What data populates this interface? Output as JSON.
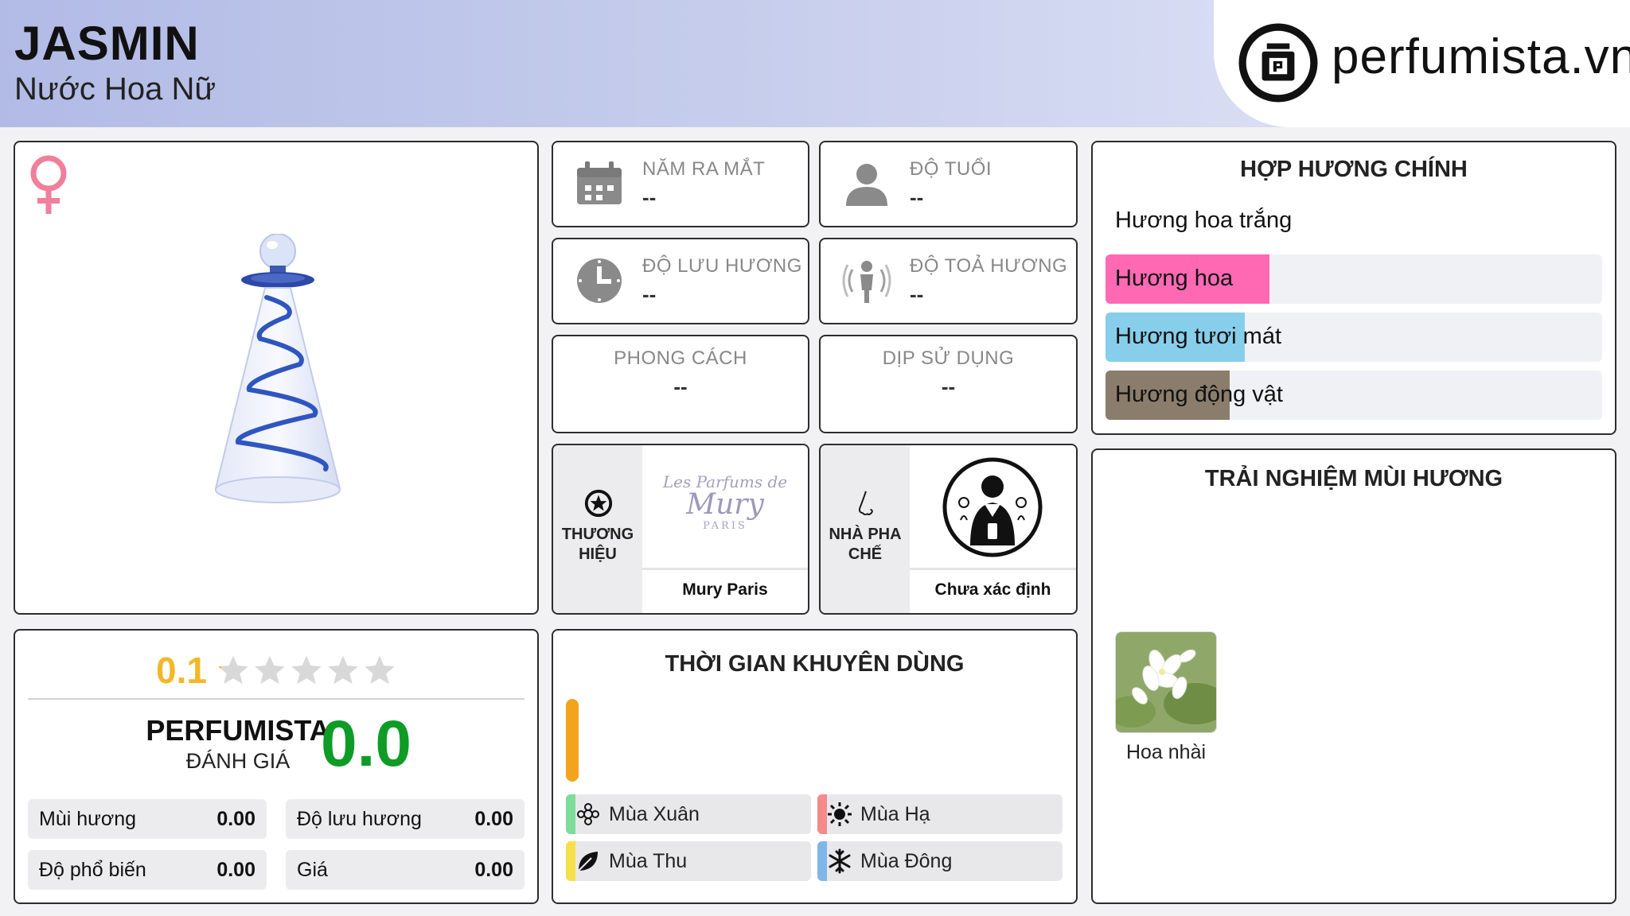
{
  "header": {
    "title": "JASMIN",
    "subtitle": "Nước Hoa Nữ",
    "logo_text": "perfumista.vn"
  },
  "product": {
    "gender_icon": "female-symbol-icon",
    "image": "perfume-bottle"
  },
  "rating": {
    "user_score": "0.1",
    "stars_total": 5,
    "stars_filled_fraction": 0.02,
    "perfumista_label": "PERFUMISTA",
    "perfumista_sublabel": "ĐÁNH GIÁ",
    "perfumista_score": "0.0",
    "metrics": [
      {
        "label": "Mùi hương",
        "value": "0.00"
      },
      {
        "label": "Độ lưu hương",
        "value": "0.00"
      },
      {
        "label": "Độ phổ biến",
        "value": "0.00"
      },
      {
        "label": "Giá",
        "value": "0.00"
      }
    ]
  },
  "info": {
    "release_year": {
      "label": "NĂM RA MẮT",
      "value": "--",
      "icon": "calendar-icon"
    },
    "age": {
      "label": "ĐỘ TUỔI",
      "value": "--",
      "icon": "person-icon"
    },
    "longevity": {
      "label": "ĐỘ LƯU HƯƠNG",
      "value": "--",
      "icon": "clock-icon"
    },
    "sillage": {
      "label": "ĐỘ TOẢ HƯƠNG",
      "value": "--",
      "icon": "sillage-icon"
    },
    "style": {
      "label": "PHONG CÁCH",
      "value": "--"
    },
    "occasion": {
      "label": "DỊP SỬ DỤNG",
      "value": "--"
    }
  },
  "brand": {
    "label_line1": "THƯƠNG",
    "label_line2": "HIỆU",
    "name": "Mury Paris",
    "logo_line1": "Les Parfums de",
    "logo_line2": "Mury",
    "logo_line3": "PARIS"
  },
  "perfumer": {
    "label_line1": "NHÀ PHA",
    "label_line2": "CHẾ",
    "name": "Chưa xác định"
  },
  "seasons": {
    "title": "THỜI GIAN KHUYÊN DÙNG",
    "items": [
      {
        "label": "Mùa Xuân",
        "color": "#7ddc9a",
        "icon": "flower-icon"
      },
      {
        "label": "Mùa Hạ",
        "color": "#f58a8a",
        "icon": "sun-icon"
      },
      {
        "label": "Mùa Thu",
        "color": "#f5e04a",
        "icon": "leaf-icon"
      },
      {
        "label": "Mùa Đông",
        "color": "#7fb6ea",
        "icon": "snowflake-icon"
      }
    ]
  },
  "accords": {
    "title": "HỢP HƯƠNG CHÍNH",
    "items": [
      {
        "label": "Hương hoa trắng",
        "color": "#ffffff",
        "level": 1.0
      },
      {
        "label": "Hương hoa",
        "color": "#ff69b4",
        "level": 0.33
      },
      {
        "label": "Hương tươi mát",
        "color": "#87ceeb",
        "level": 0.28
      },
      {
        "label": "Hương động vật",
        "color": "#8b7d6b",
        "level": 0.25
      }
    ]
  },
  "experience": {
    "title": "TRẢI NGHIỆM MÙI HƯƠNG",
    "notes": [
      {
        "name": "Hoa nhài"
      }
    ]
  }
}
